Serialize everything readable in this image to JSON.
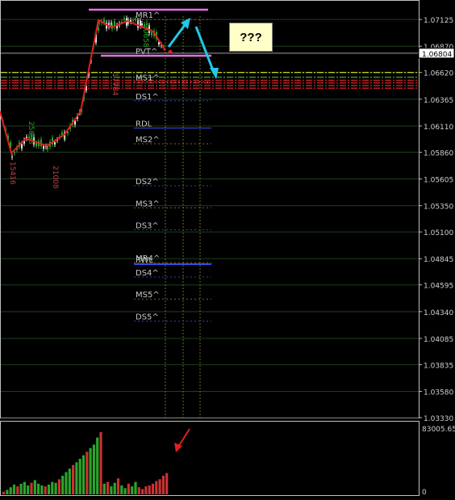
{
  "chart_data": [
    {
      "type": "candlestick",
      "yaxis": {
        "ticks": [
          1.07125,
          1.0687,
          1.0662,
          1.06365,
          1.0611,
          1.0586,
          1.05605,
          1.0535,
          1.051,
          1.04845,
          1.04595,
          1.0434,
          1.04085,
          1.03835,
          1.0358,
          1.0333
        ],
        "tick_labels": [
          "1.07125",
          "1.06870",
          "1.06620",
          "1.06365",
          "1.06110",
          "1.05860",
          "1.05605",
          "1.05350",
          "1.05100",
          "1.04845",
          "1.04595",
          "1.04340",
          "1.04085",
          "1.03835",
          "1.03580",
          "1.03330"
        ],
        "ylim": [
          1.0333,
          1.0728
        ]
      },
      "current_price": 1.06804,
      "current_price_label": "1.06804",
      "pivot_levels": [
        {
          "name": "MR1^",
          "value": 1.07125,
          "color": "#6b6b2a"
        },
        {
          "name": "PVT^",
          "value": 1.0678,
          "color": "#d0d0d0"
        },
        {
          "name": "MS1^",
          "value": 1.0653,
          "color": "#808080"
        },
        {
          "name": "DS1^",
          "value": 1.0635,
          "color": "#3c3ca8"
        },
        {
          "name": "RDL",
          "value": 1.0609,
          "color": "#3050e8"
        },
        {
          "name": "MS2^",
          "value": 1.0594,
          "color": "#6b6b2a"
        },
        {
          "name": "DS2^",
          "value": 1.0554,
          "color": "#3c3ca8"
        },
        {
          "name": "MS3^",
          "value": 1.0533,
          "color": "#6b6b2a"
        },
        {
          "name": "DS3^",
          "value": 1.0512,
          "color": "#3c3ca8"
        },
        {
          "name": "MR4^",
          "value": 1.04807,
          "color": "#6b6b2a"
        },
        {
          "name": "RWL",
          "value": 1.04793,
          "color": "#3050e8"
        },
        {
          "name": "DS4^",
          "value": 1.0467,
          "color": "#3c3ca8"
        },
        {
          "name": "MS5^",
          "value": 1.0446,
          "color": "#6b6b2a"
        },
        {
          "name": "DS5^",
          "value": 1.0425,
          "color": "#3c3ca8"
        }
      ],
      "zigzag_labels": [
        "15416",
        "21008",
        "25893",
        "17784",
        "20658"
      ],
      "annotation": "???"
    },
    {
      "type": "bar",
      "yaxis": {
        "ticks": [
          83005.65,
          0
        ],
        "tick_labels": [
          "83005.65",
          "0"
        ],
        "ylim": [
          0,
          83005.65
        ]
      },
      "series": [
        {
          "values": [
            3,
            5,
            8,
            11,
            9,
            12,
            14,
            10,
            13,
            16,
            12,
            10,
            9,
            11,
            14,
            13,
            17,
            21,
            25,
            29,
            33,
            36,
            40,
            44,
            48,
            52,
            56,
            64,
            70,
            12,
            14,
            9,
            13,
            18,
            10,
            7,
            12,
            9,
            14,
            8,
            6,
            9,
            10,
            12,
            15,
            17,
            21,
            24
          ]
        }
      ]
    }
  ],
  "colors": {
    "bg": "#000000",
    "grid": "#1f3d1f",
    "axis": "#c0c0c0",
    "bull": "#2aa52a",
    "bear": "#c83232",
    "zigzag": "#e02020",
    "arrow": "#22c8e8",
    "magenta": "#e070e0",
    "yellow_dash": "#c8c820",
    "red_dash": "#d02020"
  }
}
